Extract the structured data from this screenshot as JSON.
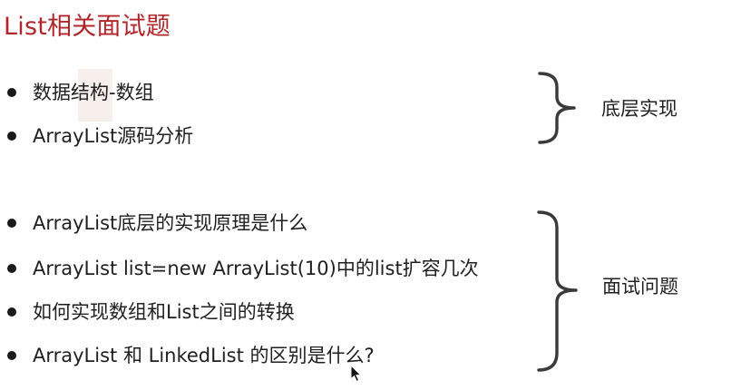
{
  "slide": {
    "title": "List相关面试题",
    "groups": [
      {
        "label": "底层实现",
        "items": [
          "数据结构-数组",
          "ArrayList源码分析"
        ]
      },
      {
        "label": "面试问题",
        "items": [
          "ArrayList底层的实现原理是什么",
          "ArrayList list=new ArrayList(10)中的list扩容几次",
          "如何实现数组和List之间的转换",
          "ArrayList 和 LinkedList 的区别是什么?"
        ]
      }
    ]
  },
  "colors": {
    "title": "#b0262b",
    "text": "#1f1f1f",
    "brace": "#3a3a3a",
    "background": "#ffffff"
  },
  "icons": {
    "bullet": "bullet-dot-icon",
    "brace": "curly-brace-icon",
    "cursor": "mouse-pointer-icon"
  }
}
